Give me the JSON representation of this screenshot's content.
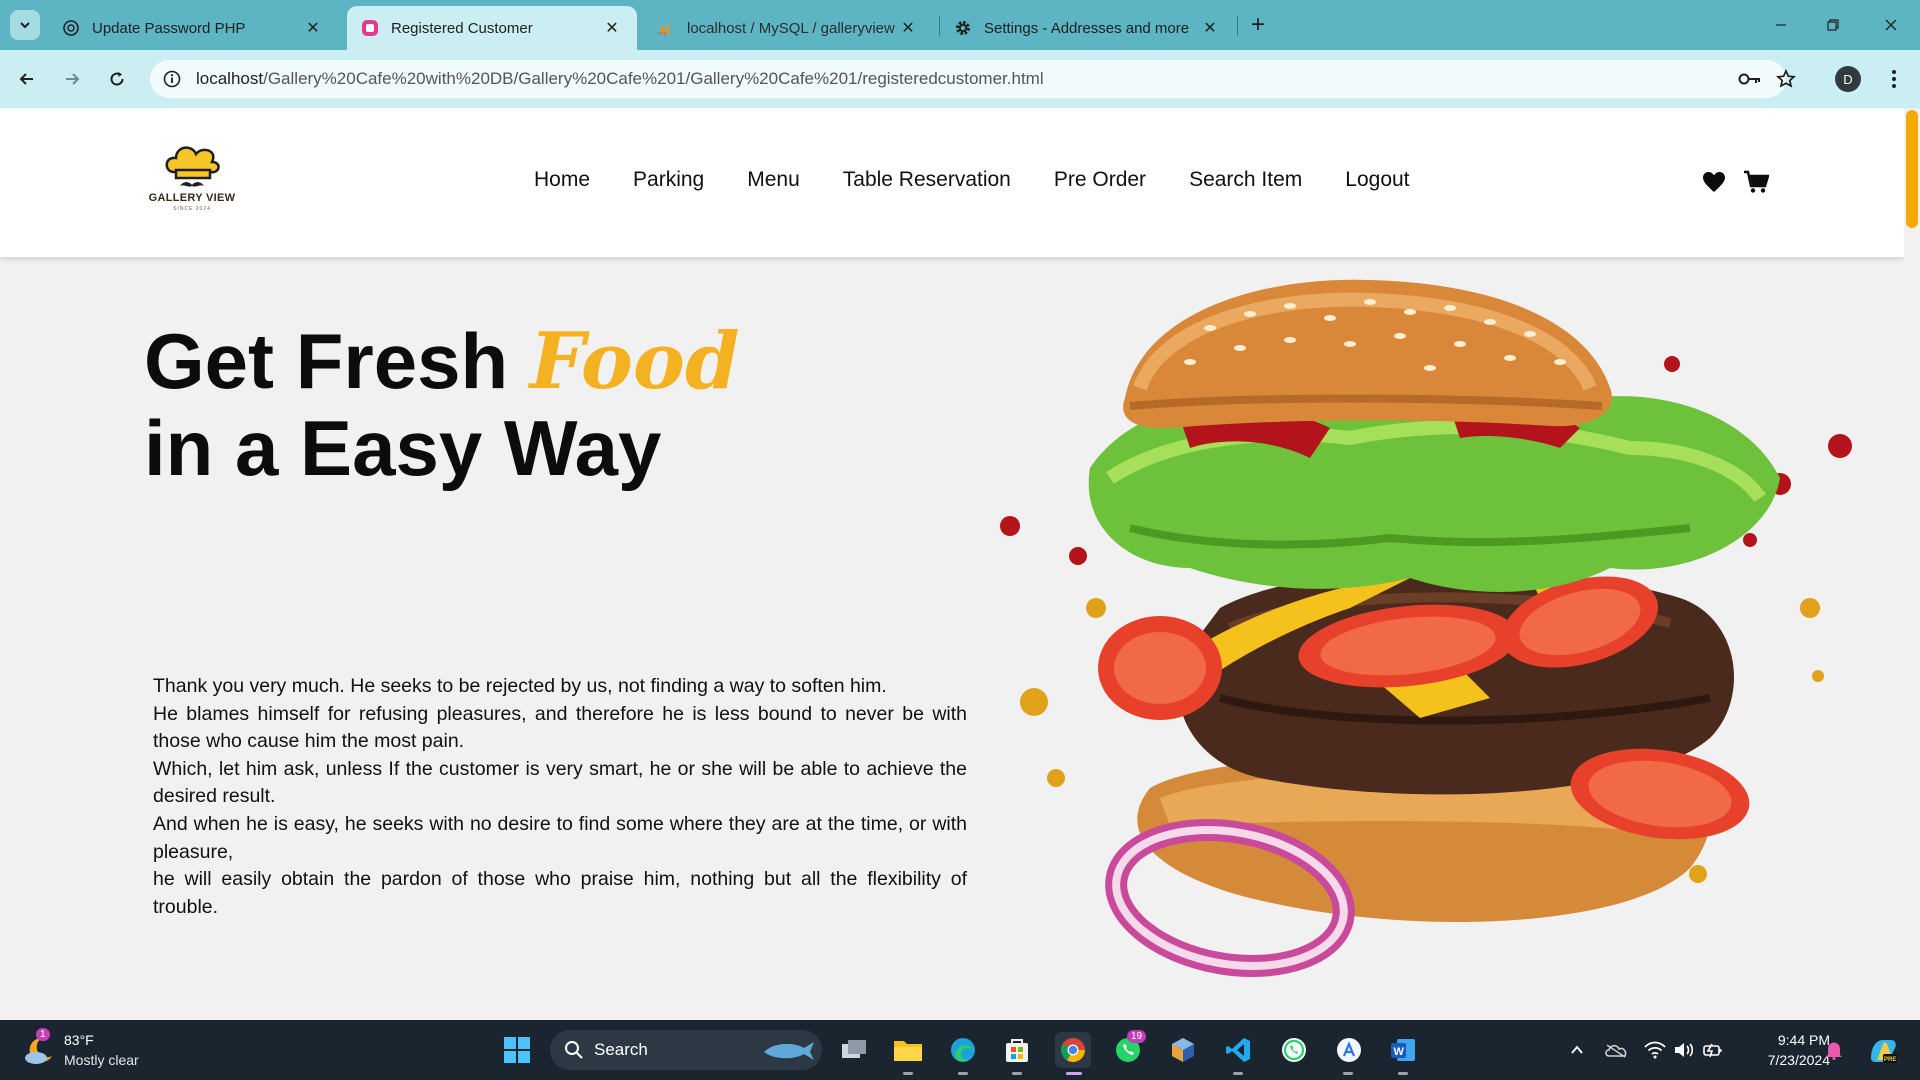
{
  "browser": {
    "tabs": [
      {
        "title": "Update Password PHP",
        "icon": "chatgpt-icon"
      },
      {
        "title": "Registered Customer",
        "icon": "site-icon"
      },
      {
        "title": "localhost / MySQL / galleryview",
        "icon": "phpmyadmin-icon"
      },
      {
        "title": "Settings - Addresses and more",
        "icon": "gear-icon"
      }
    ],
    "active_tab_index": 1,
    "url_host": "localhost",
    "url_path": "/Gallery%20Cafe%20with%20DB/Gallery%20Cafe%201/Gallery%20Cafe%201/registeredcustomer.html",
    "profile_initial": "D"
  },
  "site": {
    "logo_text": "GALLERY VIEW",
    "logo_since": "SINCE 2024",
    "nav": [
      "Home",
      "Parking",
      "Menu",
      "Table Reservation",
      "Pre Order",
      "Search Item",
      "Logout"
    ],
    "hero": {
      "title_part1": "Get Fresh ",
      "title_accent": "Food",
      "title_line2": "in a Easy Way",
      "paragraphs": [
        "Thank you very much. He seeks to be rejected by us, not finding a way to soften him.",
        "He blames himself for refusing pleasures, and therefore he is less bound to never be with those who cause him the most pain.",
        "Which, let him ask, unless If the customer is very smart, he or she will be able to achieve the desired result.",
        "And when he is easy, he seeks with no desire to find some where they are at the time, or with pleasure,",
        "he will easily obtain the pardon of those who praise him, nothing but all the flexibility of trouble."
      ]
    },
    "accent_color": "#f4b223"
  },
  "taskbar": {
    "weather_temp": "83°F",
    "weather_cond": "Mostly clear",
    "weather_badge": "1",
    "search_label": "Search",
    "whatsapp_badge": "19",
    "time": "9:44 PM",
    "date": "7/23/2024"
  }
}
